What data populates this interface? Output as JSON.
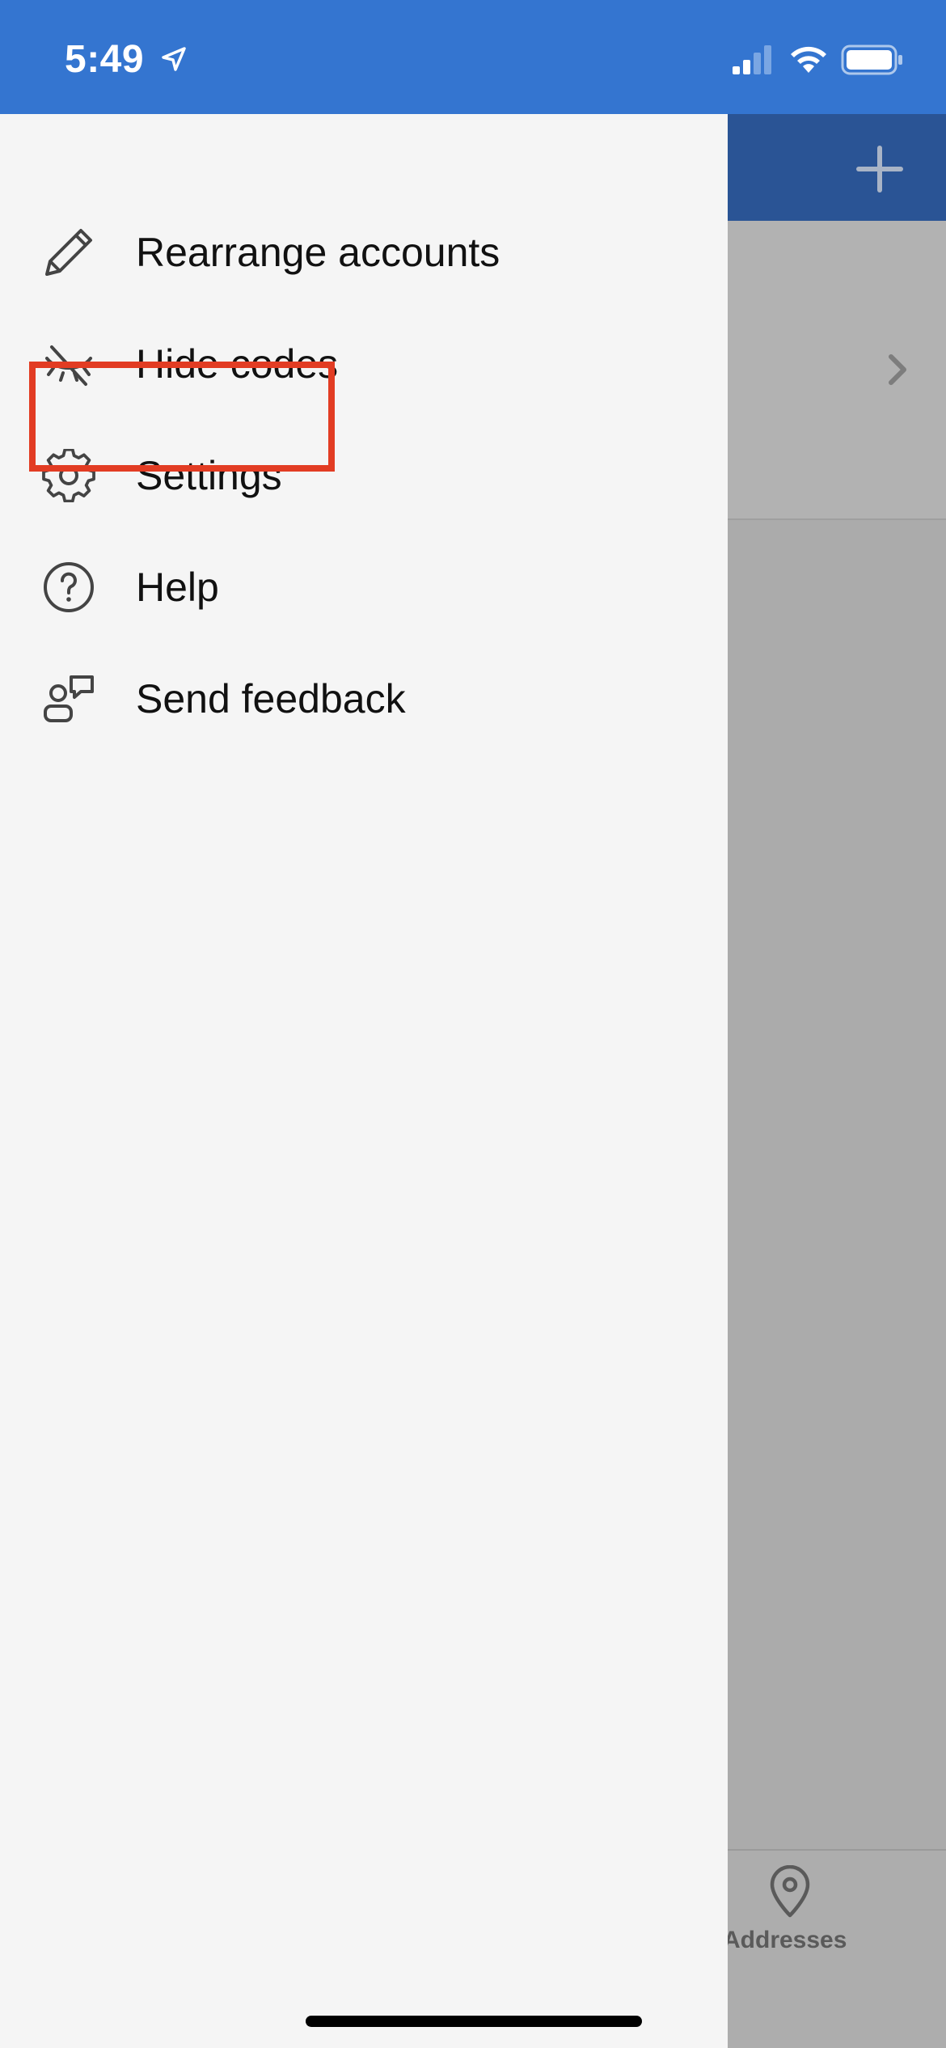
{
  "status_bar": {
    "time": "5:49",
    "background_color": "#3475d0"
  },
  "drawer": {
    "items": [
      {
        "label": "Rearrange accounts",
        "icon": "pencil-icon"
      },
      {
        "label": "Hide codes",
        "icon": "eye-off-icon"
      },
      {
        "label": "Settings",
        "icon": "gear-icon",
        "highlighted": true
      },
      {
        "label": "Help",
        "icon": "help-circle-icon"
      },
      {
        "label": "Send feedback",
        "icon": "feedback-icon"
      }
    ],
    "highlight_color": "#e23c23"
  },
  "background_app": {
    "header_color": "#2a5495",
    "tab_label": "Addresses"
  }
}
